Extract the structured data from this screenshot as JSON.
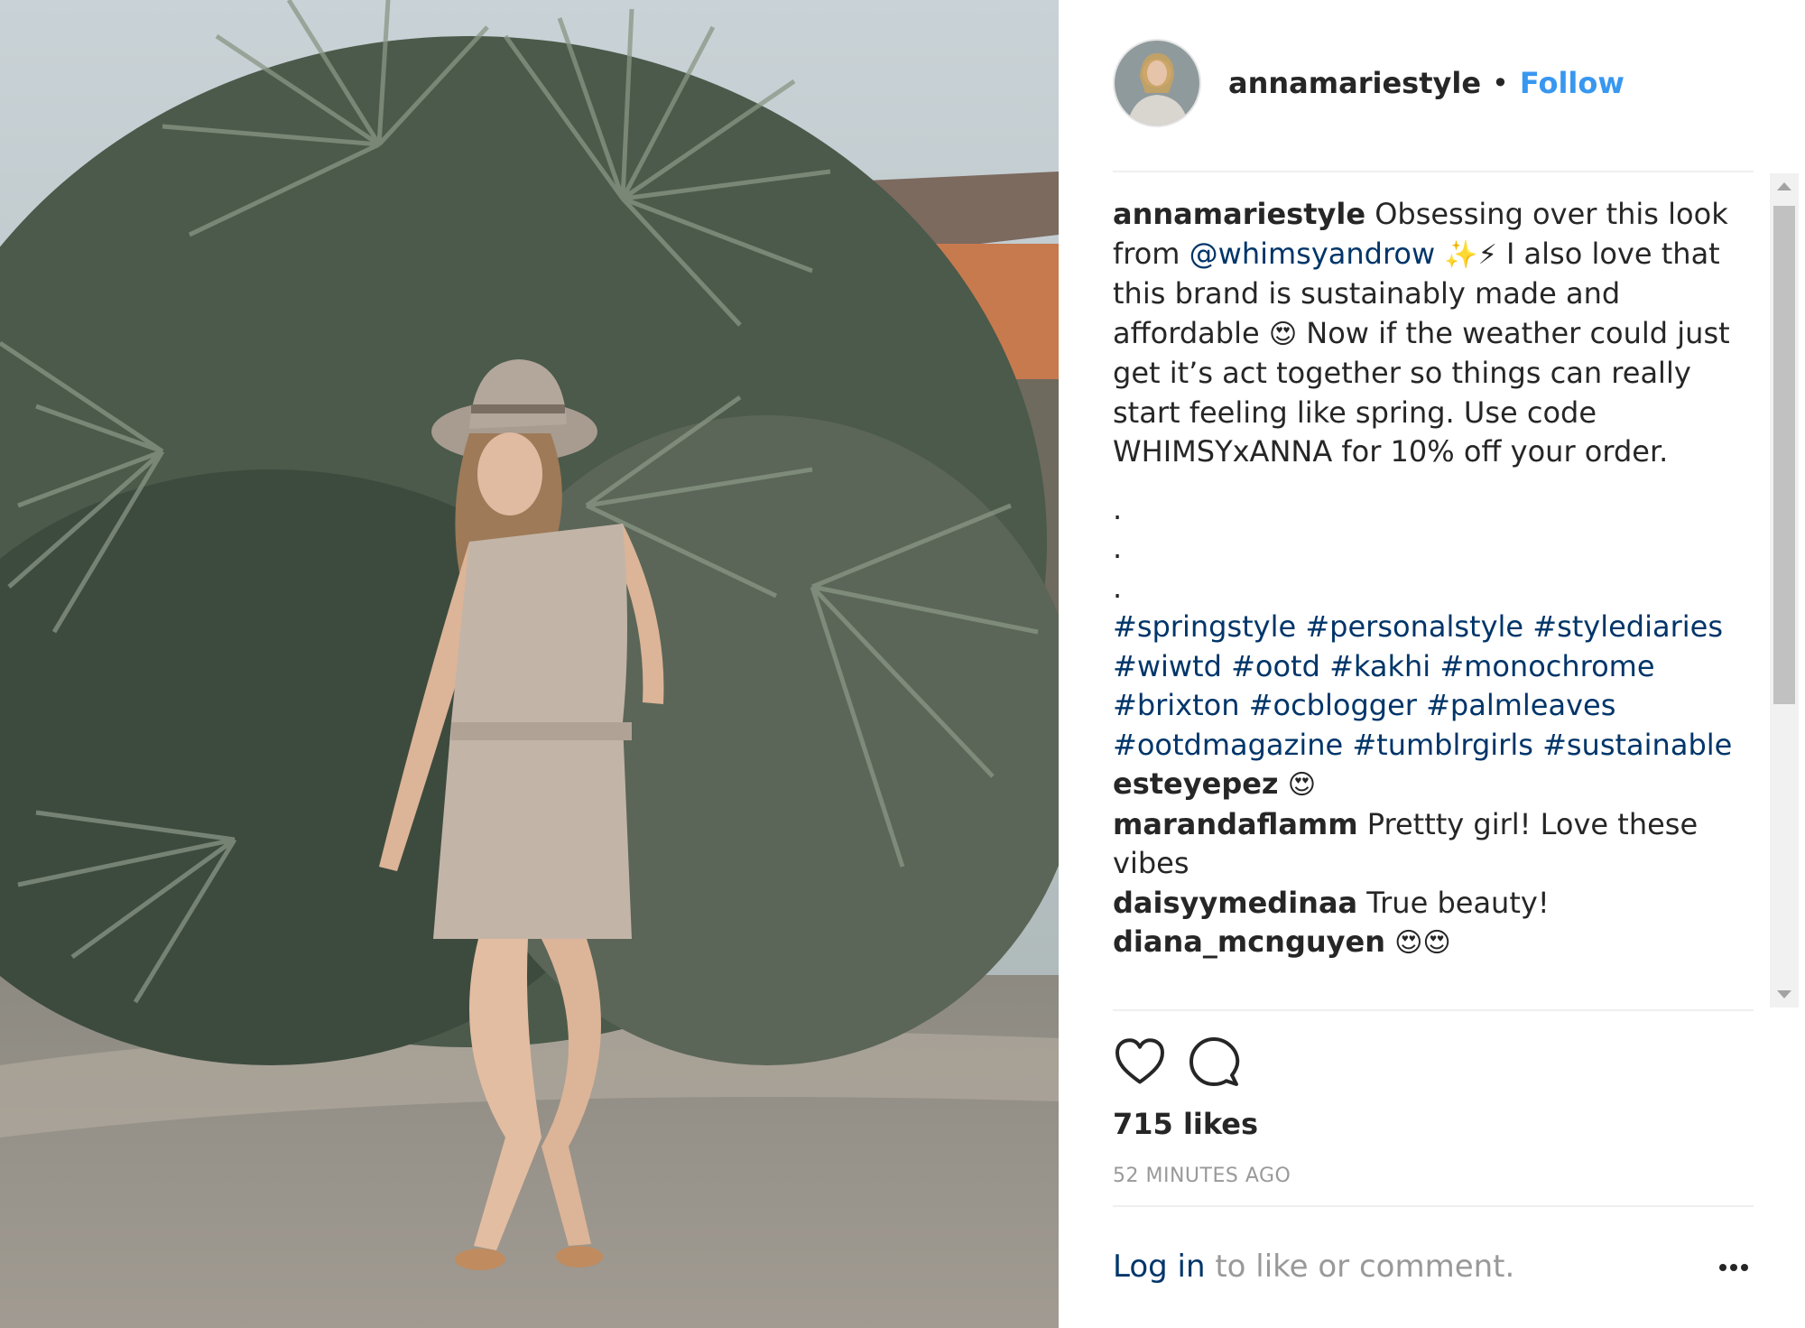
{
  "post": {
    "username": "annamariestyle",
    "separator": "•",
    "follow_label": "Follow",
    "caption": {
      "author": "annamariestyle",
      "text_1": "Obsessing over this look from",
      "mention": "@whimsyandrow",
      "emoji_1": "✨⚡",
      "text_2": "I also love that this brand is sustainably made and affordable",
      "emoji_2": "😍",
      "text_3": "Now if the weather could just get it’s act together so things can really start feeling like spring. Use code WHIMSYxANNA for 10% off your order.",
      "dots": [
        ".",
        ".",
        "."
      ],
      "hashtags": [
        "#springstyle",
        "#personalstyle",
        "#stylediaries",
        "#wiwtd",
        "#ootd",
        "#kakhi",
        "#monochrome",
        "#brixton",
        "#ocblogger",
        "#palmleaves",
        "#ootdmagazine",
        "#tumblrgirls",
        "#sustainable"
      ]
    },
    "comments": [
      {
        "user": "esteyepez",
        "text": "😍"
      },
      {
        "user": "marandaflamm",
        "text": "Prettty girl! Love these vibes"
      },
      {
        "user": "daisyymedinaa",
        "text": "True beauty!"
      },
      {
        "user": "diana_mcnguyen",
        "text": "😍😍"
      }
    ],
    "likes": "715 likes",
    "time": "52 MINUTES AGO",
    "login_link": "Log in",
    "login_text": " to like or comment.",
    "icons": [
      "heart-icon",
      "comment-icon",
      "more-options-icon"
    ]
  }
}
